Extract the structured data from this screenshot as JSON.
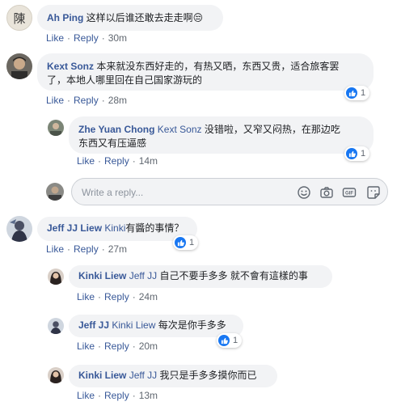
{
  "actions": {
    "like": "Like",
    "reply": "Reply"
  },
  "comments": [
    {
      "author": "Ah Ping",
      "text": "这样以后谁还敢去走走啊😒",
      "time": "30m",
      "avatar_char": "陳"
    },
    {
      "author": "Kext Sonz",
      "text_line1": "本来就没东西好走的，有热又晒，东西又贵，适合旅客罢",
      "text_line2": "了，本地人哪里回在自己国家游玩的",
      "time": "28m",
      "reactions": "1"
    },
    {
      "author": "Zhe Yuan Chong",
      "tag": "Kext Sonz",
      "text_line1": "没错啦，又窄又闷热，在那边吃",
      "text_line2": "东西又有压逼感",
      "time": "14m",
      "reactions": "1"
    },
    {
      "author": "Jeff JJ Liew",
      "tag": "Kinki",
      "text": "有醬的事情？",
      "time": "27m",
      "reactions": "1"
    },
    {
      "author": "Kinki Liew",
      "tag": "Jeff JJ",
      "text": "自己不要手多多 就不會有這樣的事",
      "time": "24m"
    },
    {
      "author": "Jeff JJ",
      "tag": "Kinki Liew",
      "text": "每次是你手多多",
      "time": "20m",
      "reactions": "1"
    },
    {
      "author": "Kinki Liew",
      "tag": "Jeff JJ",
      "text": "我只是手多多摸你而已",
      "time": "13m"
    }
  ],
  "reply_box": {
    "placeholder": "Write a reply..."
  },
  "colors": {
    "link": "#385898",
    "bubble": "#f2f3f5",
    "like_blue": "#1877f2",
    "meta": "#606770"
  }
}
